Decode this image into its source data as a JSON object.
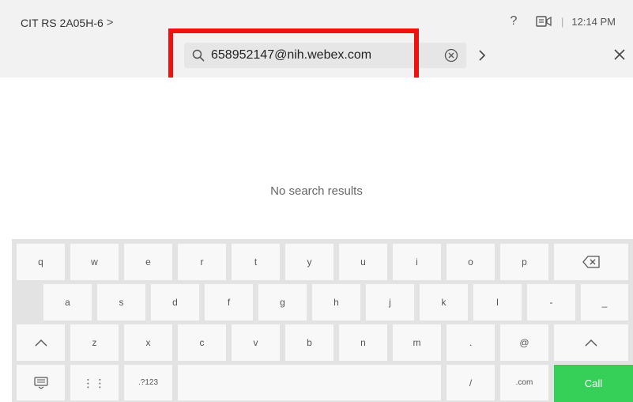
{
  "header": {
    "device_name": "CIT RS 2A05H-6",
    "device_chevron": ">",
    "help_glyph": "?",
    "separator": "|",
    "time": "12:14 PM"
  },
  "search": {
    "value": "658952147@nih.webex.com",
    "go_glyph": ">",
    "close_glyph": "×"
  },
  "results": {
    "empty_text": "No search results"
  },
  "keyboard": {
    "row1": [
      "q",
      "w",
      "e",
      "r",
      "t",
      "y",
      "u",
      "i",
      "o",
      "p"
    ],
    "row2": [
      "a",
      "s",
      "d",
      "f",
      "g",
      "h",
      "j",
      "k",
      "l",
      "-",
      "_"
    ],
    "row3": [
      "z",
      "x",
      "c",
      "v",
      "b",
      "n",
      "m",
      ".",
      "@"
    ],
    "row4": {
      "dots": "⋮⋮",
      "numbers": ".?123",
      "slash": "/",
      "dotcom": ".com",
      "call": "Call"
    }
  },
  "colors": {
    "header_bg": "#f2f2f2",
    "highlight": "#ee1111",
    "call_green": "#36d058",
    "keyboard_bg": "#e3e3e3"
  },
  "icons": [
    "search-icon",
    "clear-icon",
    "help-icon",
    "camera-icon",
    "close-icon",
    "backspace-icon",
    "shift-icon",
    "keyboard-icon"
  ]
}
